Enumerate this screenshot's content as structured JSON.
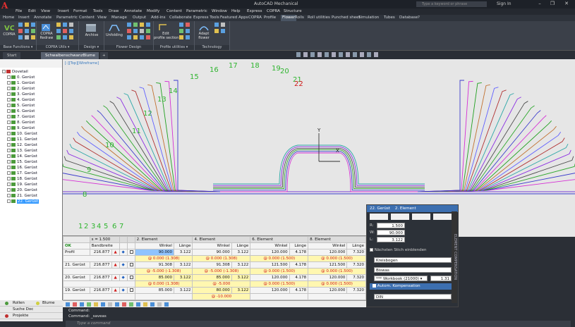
{
  "titlebar": {
    "title": "AutoCAD Mechanical",
    "search_placeholder": "Type a keyword or phrase",
    "signin": "Sign In",
    "minimize": "–",
    "maximize": "❐",
    "close": "✕"
  },
  "menu": [
    "File",
    "Edit",
    "View",
    "Insert",
    "Format",
    "Tools",
    "Draw",
    "Annotate",
    "Modify",
    "Content",
    "Parametric",
    "Window",
    "Help",
    "Express",
    "COPRA",
    "Structure"
  ],
  "ribbon_tabs": [
    "Home",
    "Insert",
    "Annotate",
    "Parametric",
    "Content",
    "View",
    "Manage",
    "Output",
    "Add-ins",
    "Collaborate",
    "Express Tools",
    "Featured Apps",
    "COPRA",
    "Profile",
    "Flower",
    "Rolls",
    "Roll utilities",
    "Punched sheet",
    "Simulation",
    "Tubes",
    "Database",
    "?"
  ],
  "ribbon_active_tab": "Flower",
  "ribbon": {
    "copra_btn": "COPRA",
    "copra_redraw": "COPRA\nRedraw",
    "archive": "Archive",
    "unfolding": "Unfolding",
    "edit_profile_section": "Edit\nprofile section",
    "adapt_flower": "Adapt\nflower",
    "groups": [
      "Base Functions ▾",
      "COPRA Utils ▾",
      "Design ▾",
      "Flower Design",
      "Profile utilities ▾",
      "Technology"
    ]
  },
  "doc_tabs": [
    "Start",
    "SchwalbenschwanzBlume"
  ],
  "doc_tab_close": "✕",
  "doc_tab_add": "+",
  "canvas_label": "[-][Top][Wireframe]",
  "axes": {
    "y": "Y",
    "x": "X"
  },
  "tree": {
    "root": "Dovetail",
    "items": [
      "0. Gerüst",
      "1. Gerüst",
      "2. Gerüst",
      "3. Gerüst",
      "4. Gerüst",
      "5. Gerüst",
      "6. Gerüst",
      "7. Gerüst",
      "8. Gerüst",
      "9. Gerüst",
      "10. Gerüst",
      "11. Gerüst",
      "12. Gerüst",
      "13. Gerüst",
      "14. Gerüst",
      "15. Gerüst",
      "16. Gerüst",
      "17. Gerüst",
      "18. Gerüst",
      "19. Gerüst",
      "20. Gerüst",
      "21. Gerüst",
      "22. Gerüst"
    ],
    "selected": "22. Gerüst",
    "bottom": [
      "Rollen",
      "Blume",
      "Suche Doc",
      "Projekte"
    ]
  },
  "stage_labels": [
    "1",
    "2",
    "3",
    "4",
    "5",
    "6",
    "7",
    "8",
    "9",
    "10",
    "11",
    "12",
    "13",
    "14",
    "15",
    "16",
    "17",
    "18",
    "19",
    "20",
    "21",
    "22"
  ],
  "table": {
    "s_label": "s = 1.500",
    "ok": "OK",
    "bandbreite": "Bandbreite",
    "element_headers": [
      "2. Element",
      "4. Element",
      "6. Element",
      "8. Element"
    ],
    "sub_headers": [
      "Winkel",
      "Länge"
    ],
    "rows": [
      {
        "name": "Profil",
        "bw": "216.877",
        "cells": [
          "90.000",
          "3.122",
          "90.000",
          "3.122",
          "120.000",
          "4.178",
          "120.000",
          "7.320"
        ],
        "sub": [
          "@ 0.000 (1.308)",
          "@ 0.000 (1.308)",
          "@ 0.000 (1.500)",
          "@ 0.000 (1.500)"
        ]
      },
      {
        "name": "21. Gerüst",
        "bw": "216.877",
        "cells": [
          "91.308",
          "3.122",
          "91.308",
          "3.122",
          "121.500",
          "4.178",
          "121.500",
          "7.320"
        ],
        "sub": [
          "@ -5.000 (-1.308)",
          "@ -5.000 (-1.308)",
          "@ 0.000 (1.500)",
          "@ 0.000 (1.500)"
        ]
      },
      {
        "name": "20. Gerüst",
        "bw": "216.877",
        "cells": [
          "85.000",
          "3.122",
          "85.000",
          "3.122",
          "120.000",
          "4.178",
          "120.000",
          "7.320"
        ],
        "sub": [
          "@ 0.000 (1.308)",
          "@ -5.000",
          "@ 0.000 (1.500)",
          "@ 0.000 (1.500)"
        ]
      },
      {
        "name": "19. Gerüst",
        "bw": "216.877",
        "cells": [
          "85.000",
          "3.122",
          "80.000",
          "3.122",
          "120.000",
          "4.178",
          "120.000",
          "7.320"
        ],
        "sub": [
          "",
          "@ -10.000",
          "",
          ""
        ]
      }
    ]
  },
  "element_panel": {
    "header_a": "22. Gerüst",
    "header_b": "2. Element",
    "fields": [
      {
        "label": "R:",
        "value": "1.500"
      },
      {
        "label": "W:",
        "value": "90.000"
      },
      {
        "label": "L:",
        "value": "3.122"
      }
    ],
    "checkbox1": "Nächsten Stich einblenden",
    "dropdowns": [
      "Kreisbogen",
      "Biswas"
    ],
    "workbook": "*** Workbook (21000) ▾",
    "workbook_value": "1.31",
    "checkbox2": "Autom. Kompensation",
    "norm": "DIN",
    "side_label": "ELEMENT COMPENSATION"
  },
  "command": {
    "line1": "Command:",
    "line2": "Command:  _saveas",
    "prompt": "Type a command"
  },
  "colors": {
    "accent": "#3c6fb0",
    "label_green": "#2fb52f",
    "label_red": "#d01818"
  }
}
